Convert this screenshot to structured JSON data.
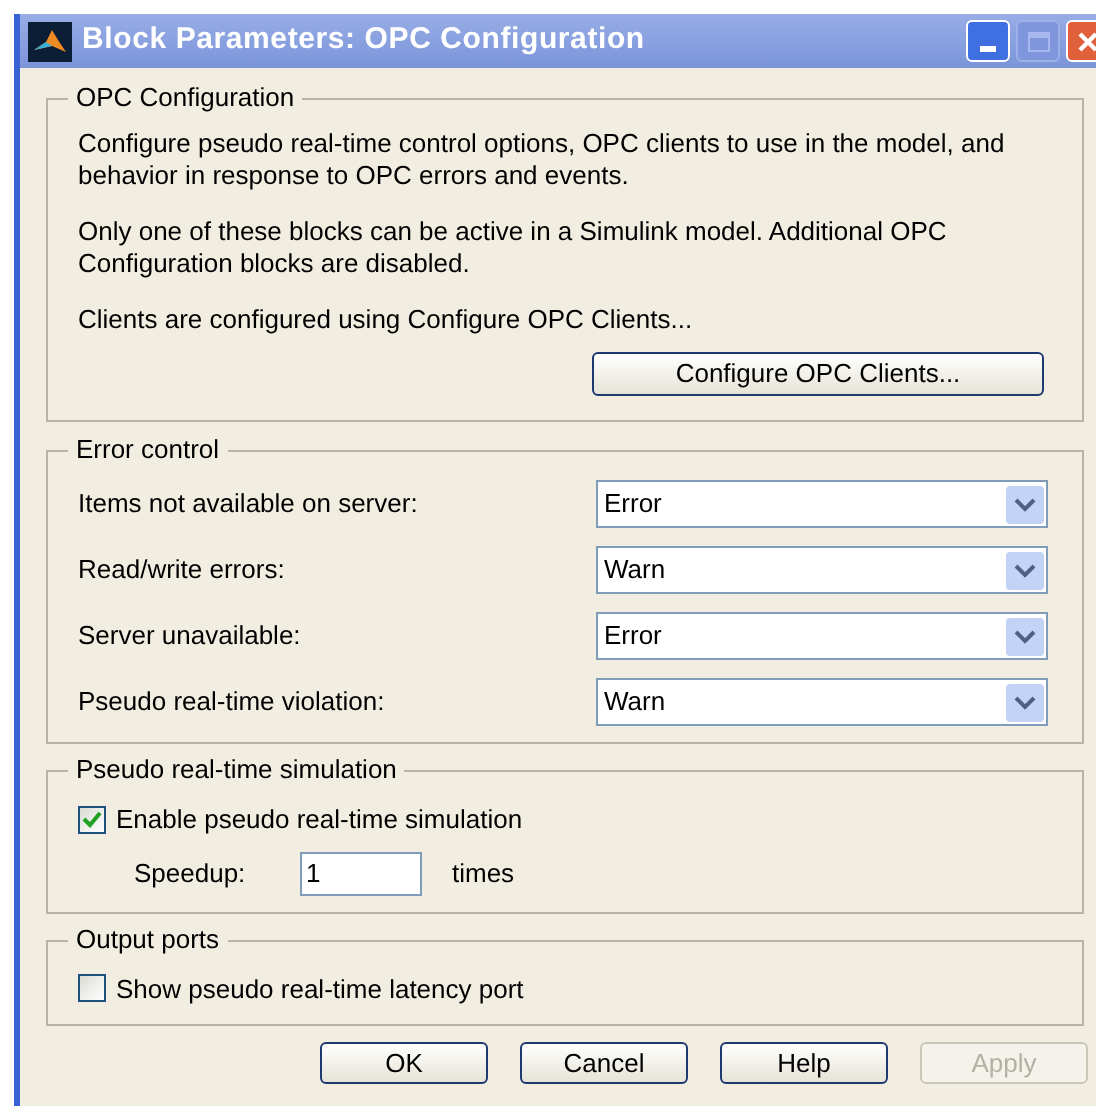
{
  "window": {
    "title": "Block Parameters: OPC Configuration",
    "controls": [
      {
        "kind": "minimize",
        "disabled": false
      },
      {
        "kind": "maximize",
        "disabled": true
      },
      {
        "kind": "close",
        "disabled": false
      }
    ]
  },
  "opc_configuration": {
    "title": "OPC Configuration",
    "paragraphs": [
      "Configure pseudo real-time control options, OPC clients to use in the model, and behavior in response to OPC errors and events.",
      "Only one of these blocks can be active in a Simulink model. Additional OPC Configuration blocks are disabled.",
      "Clients are configured using Configure OPC Clients..."
    ],
    "button": "Configure OPC Clients..."
  },
  "error_control": {
    "title": "Error control",
    "rows": [
      {
        "label": "Items not available on server:",
        "value": "Error"
      },
      {
        "label": "Read/write errors:",
        "value": "Warn"
      },
      {
        "label": "Server unavailable:",
        "value": "Error"
      },
      {
        "label": "Pseudo real-time violation:",
        "value": "Warn"
      }
    ]
  },
  "pseudo_real_time_simulation": {
    "title": "Pseudo real-time simulation",
    "checkbox": {
      "label": "Enable pseudo real-time simulation",
      "checked": true
    },
    "speedup": {
      "label": "Speedup:",
      "value": "1",
      "unit": "times"
    }
  },
  "output_ports": {
    "title": "Output ports",
    "checkbox": {
      "label": "Show pseudo real-time latency port",
      "checked": false
    }
  },
  "buttons": [
    {
      "label": "OK",
      "disabled": false
    },
    {
      "label": "Cancel",
      "disabled": false
    },
    {
      "label": "Help",
      "disabled": false
    },
    {
      "label": "Apply",
      "disabled": true
    }
  ]
}
